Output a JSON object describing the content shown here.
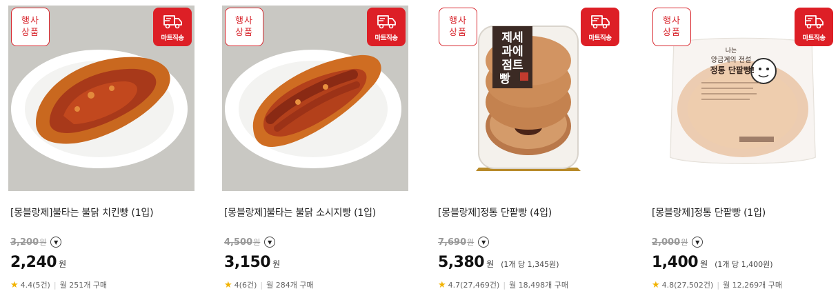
{
  "products": [
    {
      "title": "[몽블랑제]불타는 불닭 치킨빵 (1입)",
      "badge_event": [
        "행사",
        "상품"
      ],
      "badge_mart": "마트직송",
      "original_price": "3,200",
      "original_unit": "원",
      "price": "2,240",
      "price_unit": "원",
      "unit_price": "",
      "rating": "4.4(5건)",
      "monthly": "월 251개 구매"
    },
    {
      "title": "[몽블랑제]불타는 불닭 소시지빵 (1입)",
      "badge_event": [
        "행사",
        "상품"
      ],
      "badge_mart": "마트직송",
      "original_price": "4,500",
      "original_unit": "원",
      "price": "3,150",
      "price_unit": "원",
      "unit_price": "",
      "rating": "4(6건)",
      "monthly": "월 284개 구매"
    },
    {
      "title": "[몽블랑제]정통 단팥빵 (4입)",
      "badge_event": [
        "행사",
        "상품"
      ],
      "badge_mart": "마트직송",
      "original_price": "7,690",
      "original_unit": "원",
      "price": "5,380",
      "price_unit": "원",
      "unit_price": "(1개 당 1,345원)",
      "rating": "4.7(27,469건)",
      "monthly": "월 18,498개 구매",
      "package_text": [
        "제세",
        "과에",
        "점트",
        "빵"
      ]
    },
    {
      "title": "[몽블랑제]정통 단팥빵 (1입)",
      "badge_event": [
        "행사",
        "상품"
      ],
      "badge_mart": "마트직송",
      "original_price": "2,000",
      "original_unit": "원",
      "price": "1,400",
      "price_unit": "원",
      "unit_price": "(1개 당 1,400원)",
      "rating": "4.8(27,502건)",
      "monthly": "월 12,269개 구매",
      "package_text": [
        "나는",
        "앙금계의 전설",
        "정통 단팥빵!"
      ]
    }
  ],
  "colors": {
    "accent": "#dd1f26",
    "star": "#f2b300"
  },
  "icons": {
    "delivery": "truck-icon",
    "info": "chevron-down-icon",
    "rating": "star-icon"
  }
}
